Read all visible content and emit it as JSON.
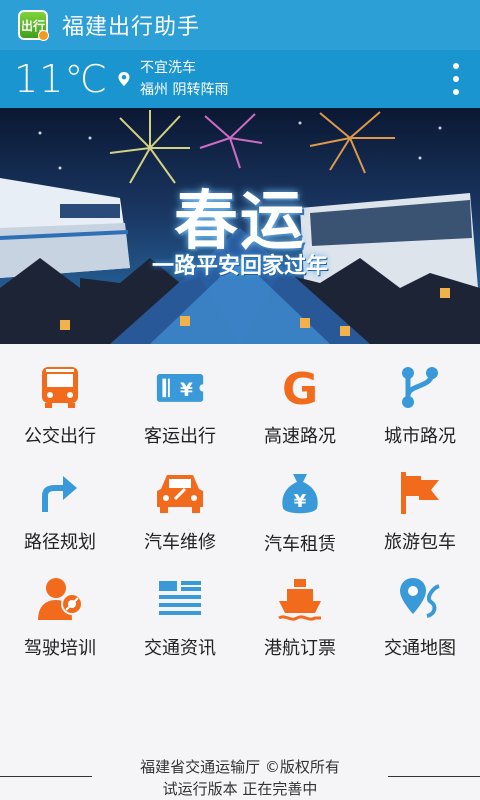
{
  "app": {
    "title": "福建出行助手",
    "logo_text": "出行"
  },
  "weather": {
    "temperature": "11℃",
    "advice": "不宜洗车",
    "city": "福州",
    "condition": "阴转阵雨"
  },
  "banner": {
    "title": "春运",
    "subtitle": "一路平安回家过年"
  },
  "colors": {
    "header": "#2b9fd6",
    "weather_bar": "#1a95cf",
    "icon_orange": "#f26b1d",
    "icon_blue": "#3a8fd8"
  },
  "menu": [
    {
      "label": "公交出行",
      "icon": "bus-icon"
    },
    {
      "label": "客运出行",
      "icon": "ticket-icon"
    },
    {
      "label": "高速路况",
      "icon": "highway-g-icon"
    },
    {
      "label": "城市路况",
      "icon": "route-branch-icon"
    },
    {
      "label": "路径规划",
      "icon": "route-arrow-icon"
    },
    {
      "label": "汽车维修",
      "icon": "car-repair-icon"
    },
    {
      "label": "汽车租赁",
      "icon": "money-bag-icon"
    },
    {
      "label": "旅游包车",
      "icon": "flag-icon"
    },
    {
      "label": "驾驶培训",
      "icon": "instructor-icon"
    },
    {
      "label": "交通资讯",
      "icon": "news-icon"
    },
    {
      "label": "港航订票",
      "icon": "ship-icon"
    },
    {
      "label": "交通地图",
      "icon": "map-pin-icon"
    }
  ],
  "footer": {
    "line1": "福建省交通运输厅 ©版权所有",
    "line2": "试运行版本 正在完善中"
  }
}
